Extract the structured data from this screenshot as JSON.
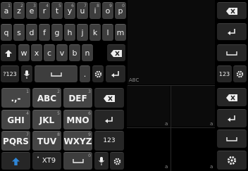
{
  "qwerty": {
    "row1": [
      {
        "label": "a",
        "hint": "1"
      },
      {
        "label": "z",
        "hint": "2"
      },
      {
        "label": "e",
        "hint": "3"
      },
      {
        "label": "r",
        "hint": "4"
      },
      {
        "label": "t",
        "hint": "5"
      },
      {
        "label": "y",
        "hint": "6"
      },
      {
        "label": "u",
        "hint": "7"
      },
      {
        "label": "i",
        "hint": "8"
      },
      {
        "label": "o",
        "hint": "9"
      },
      {
        "label": "p",
        "hint": "0"
      }
    ],
    "row2": [
      "q",
      "s",
      "d",
      "f",
      "g",
      "h",
      "j",
      "k",
      "l",
      "m"
    ],
    "row3": [
      "w",
      "x",
      "c",
      "v",
      "b",
      "n"
    ],
    "mode_label": "?123",
    "period_label": "."
  },
  "pane_label": "ABC",
  "t9": {
    "row1": [
      {
        "label": ".,-",
        "hint": "1"
      },
      {
        "label": "ABC",
        "hint": "2"
      },
      {
        "label": "DEF",
        "hint": "3"
      }
    ],
    "row2": [
      {
        "label": "GHI",
        "hint": "4"
      },
      {
        "label": "JKL",
        "hint": "5"
      },
      {
        "label": "MNO",
        "hint": "6"
      }
    ],
    "row3": [
      {
        "label": "PQRS",
        "hint": "7"
      },
      {
        "label": "TUV",
        "hint": "8"
      },
      {
        "label": "WXYZ",
        "hint": "9"
      }
    ],
    "space_hint": "0",
    "t9_label": "XT9",
    "mode_label": "123"
  },
  "side_top": {
    "mode_label": "123"
  },
  "pane_markers": [
    "a",
    "a",
    "a",
    "a",
    "a"
  ],
  "colors": {
    "key": "#3d3d3d",
    "key_dark": "#262626",
    "accent": "#2f86d6",
    "background": "#000000"
  }
}
